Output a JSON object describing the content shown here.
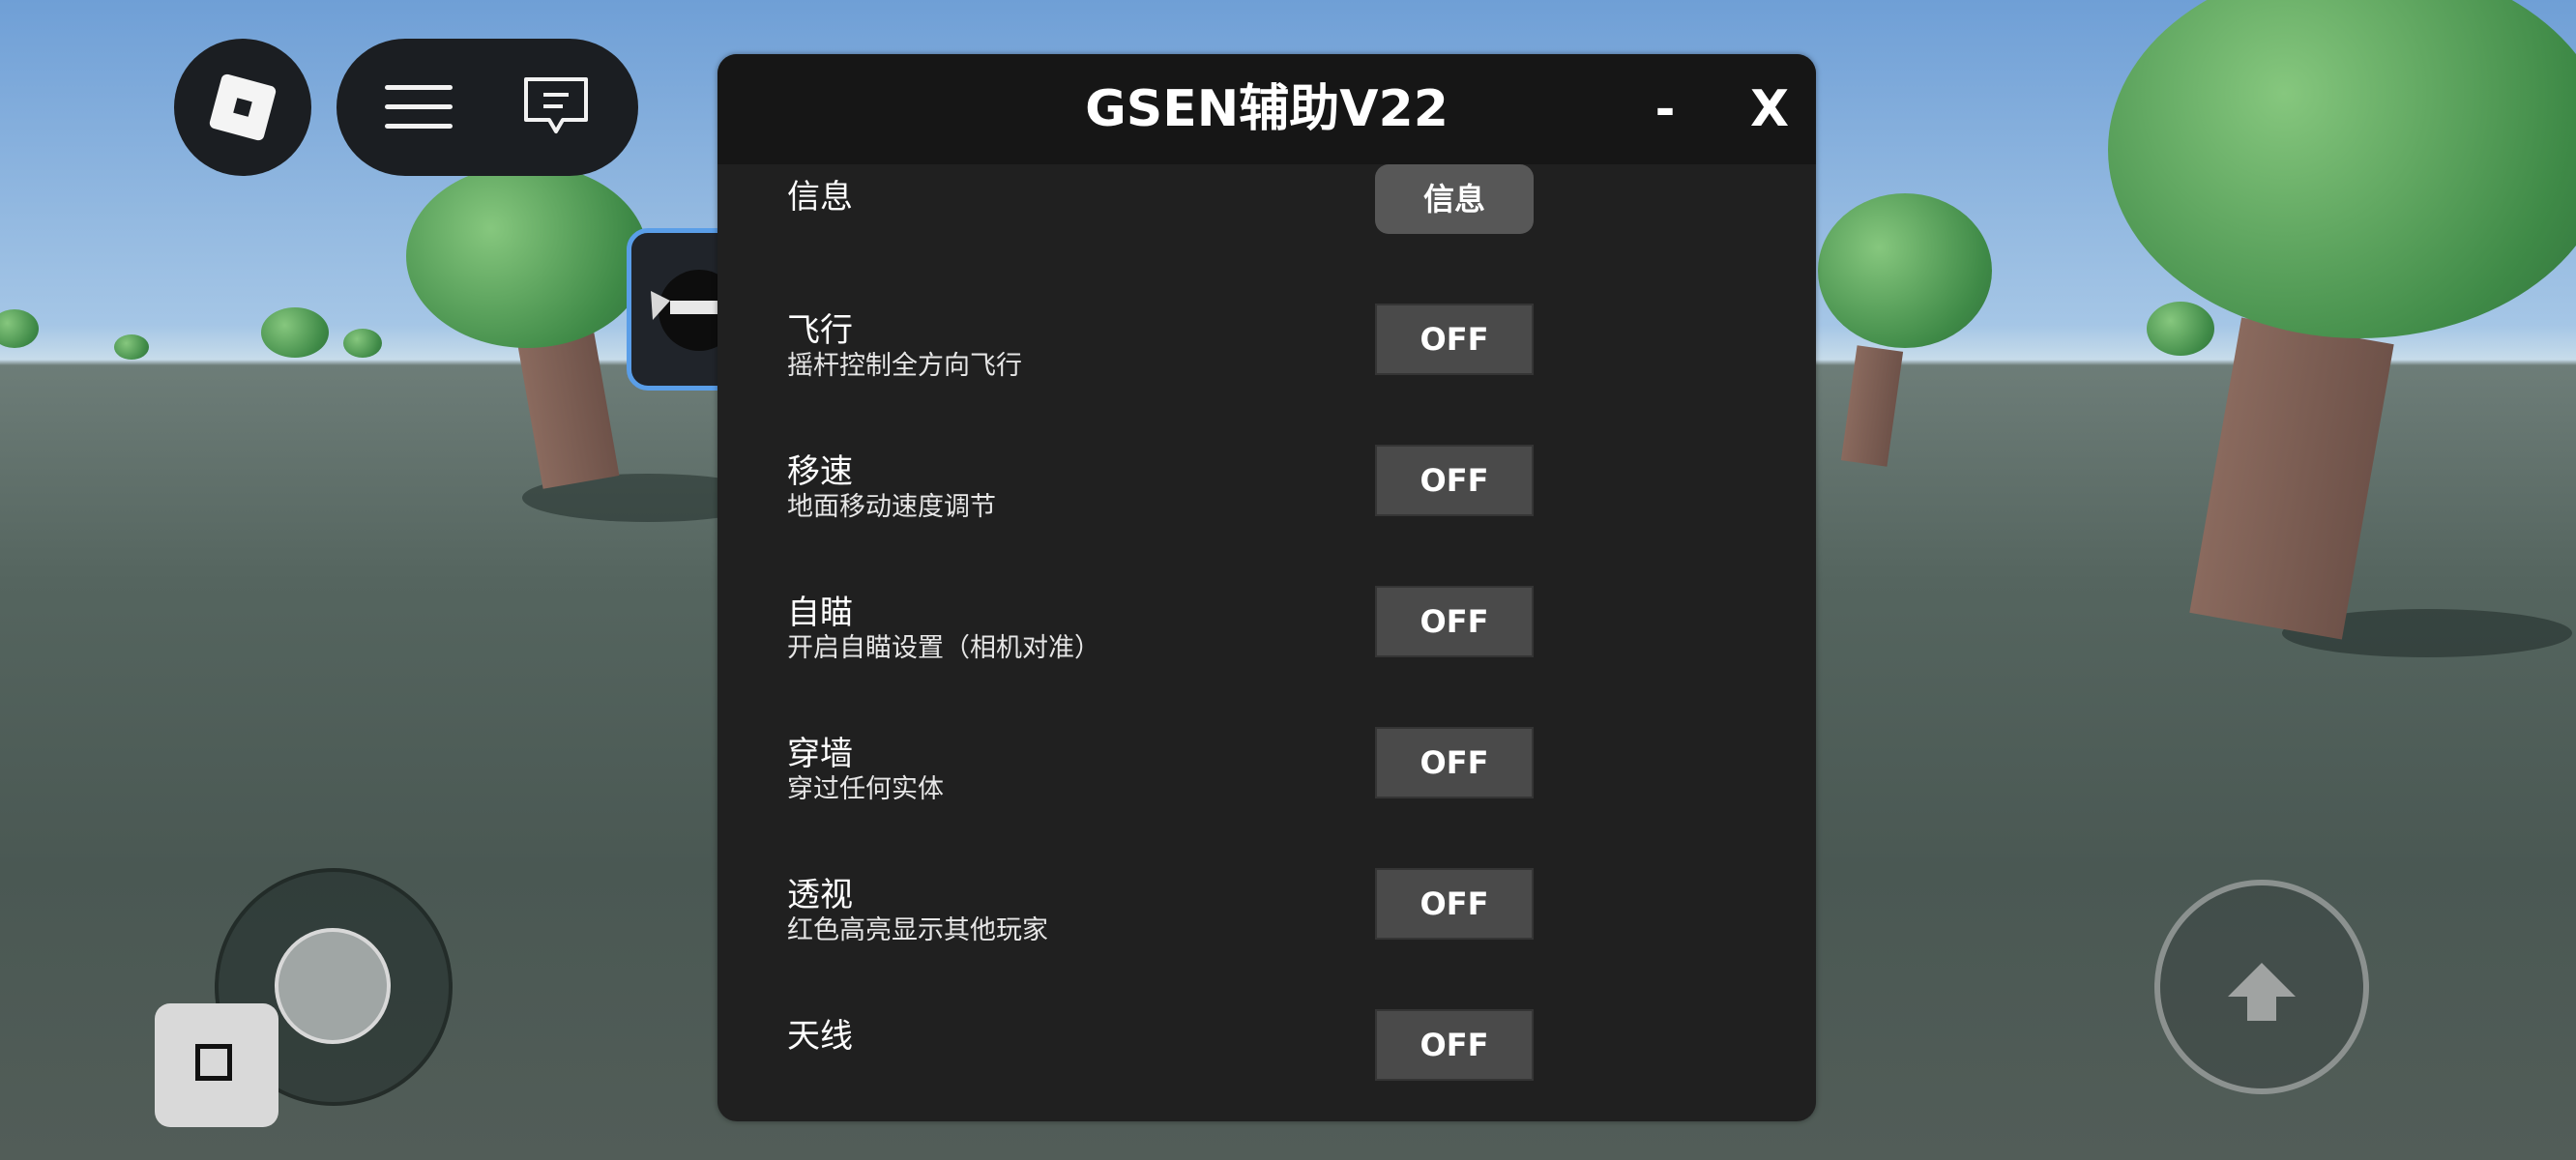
{
  "panel": {
    "title": "GSEN辅助V22",
    "minimize_label": "-",
    "close_label": "X"
  },
  "rows": [
    {
      "title": "信息",
      "subtitle": "",
      "button": "信息"
    },
    {
      "title": "飞行",
      "subtitle": "摇杆控制全方向飞行",
      "button": "OFF"
    },
    {
      "title": "移速",
      "subtitle": "地面移动速度调节",
      "button": "OFF"
    },
    {
      "title": "自瞄",
      "subtitle": "开启自瞄设置（相机对准）",
      "button": "OFF"
    },
    {
      "title": "穿墙",
      "subtitle": "穿过任何实体",
      "button": "OFF"
    },
    {
      "title": "透视",
      "subtitle": "红色高亮显示其他玩家",
      "button": "OFF"
    },
    {
      "title": "天线",
      "subtitle": "",
      "button": "OFF"
    }
  ],
  "icons": {
    "roblox": "roblox-logo-icon",
    "menu": "hamburger-menu-icon",
    "chat": "chat-icon",
    "jump": "jump-arrow-icon",
    "square": "square-icon"
  }
}
